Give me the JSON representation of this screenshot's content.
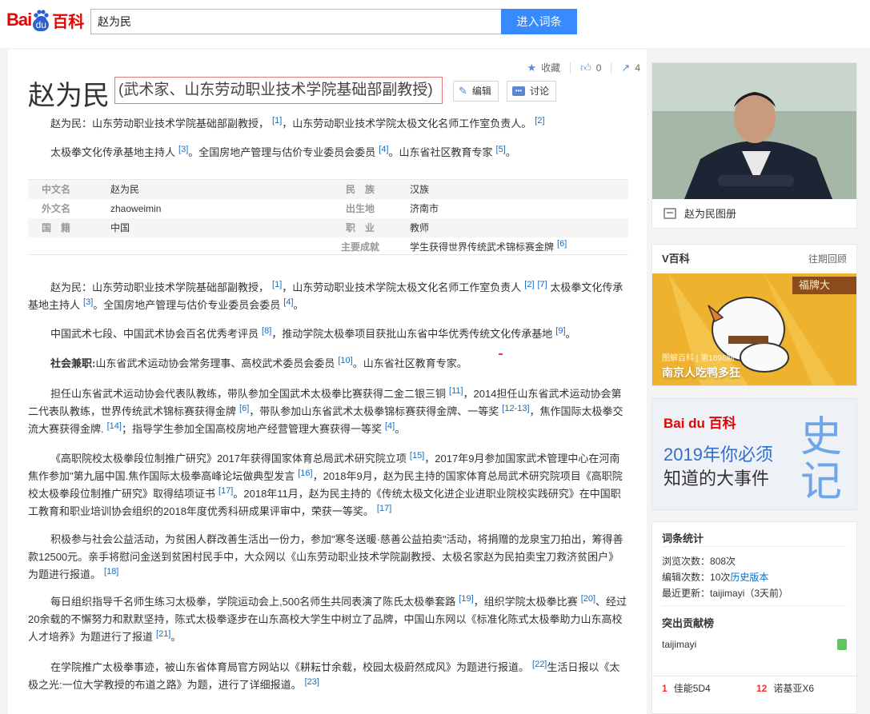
{
  "header": {
    "logo_bai": "Bai",
    "logo_du": "du",
    "logo_baike": "百科",
    "search_value": "赵为民",
    "search_button": "进入词条"
  },
  "toolbar": {
    "favorite_label": "收藏",
    "like_count": "0",
    "share_count": "4"
  },
  "lemma": {
    "title": "赵为民",
    "subtitle": "(武术家、山东劳动职业技术学院基础部副教授)",
    "edit_label": "编辑",
    "discuss_label": "讨论"
  },
  "summary": {
    "p1_text": "赵为民：山东劳动职业技术学院基础部副教授，",
    "p1_ref1": "[1]",
    "p1_text2": "，山东劳动职业技术学院太极文化名师工作室负责人。",
    "p1_ref2": "[2]",
    "p2_text": "太极拳文化传承基地主持人",
    "p2_ref1": "[3]",
    "p2_text2": "。全国房地产管理与估价专业委员会委员",
    "p2_ref2": "[4]",
    "p2_text3": "。山东省社区教育专家",
    "p2_ref3": "[5]",
    "p2_text4": "。"
  },
  "basic_info": {
    "left": [
      {
        "key": "中文名",
        "value": "赵为民"
      },
      {
        "key": "外文名",
        "value": "zhaoweimin"
      },
      {
        "key": "国　籍",
        "value": "中国"
      }
    ],
    "right": [
      {
        "key": "民　族",
        "value": "汉族"
      },
      {
        "key": "出生地",
        "value": "济南市"
      },
      {
        "key": "职　业",
        "value": "教师"
      },
      {
        "key": "主要成就",
        "value": "学生获得世界传统武术锦标赛金牌",
        "ref": "[6]"
      }
    ]
  },
  "body": {
    "b1": {
      "t1": "赵为民：山东劳动职业技术学院基础部副教授，",
      "r1": "[1]",
      "t2": "，山东劳动职业技术学院太极文化名师工作室负责人",
      "r2": "[2]",
      "r3": "[7]",
      "t3": "太极拳文化传承基地主持人",
      "r4": "[3]",
      "t4": "。全国房地产管理与估价专业委员会委员",
      "r5": "[4]",
      "t5": "。"
    },
    "b2": {
      "t1": "中国武术七段、中国武术协会百名优秀考评员",
      "r1": "[8]",
      "t2": "，推动学院太极拳项目获批山东省中华优秀传统文化传承基地",
      "r2": "[9]",
      "t3": "。"
    },
    "b3": {
      "label": "社会兼职:",
      "t1": "山东省武术运动协会常务理事、高校武术委员会委员",
      "r1": "[10]",
      "t2": "。山东省社区教育专家。"
    },
    "b4": {
      "t1": "担任山东省武术运动协会代表队教练，带队参加全国武术太极拳比赛获得二金二银三铜",
      "r1": "[11]",
      "t2": "，2014担任山东省武术运动协会第二代表队教练，世界传统武术锦标赛获得金牌",
      "r2": "[6]",
      "t3": "，带队参加山东省武术太极拳锦标赛获得金牌、一等奖",
      "r3": "[12-13]",
      "t4": "，焦作国际太极拳交流大赛获得金牌.",
      "r4": "[14]",
      "t5": "；指导学生参加全国高校房地产经营管理大赛获得一等奖",
      "r5": "[4]",
      "t6": "。"
    },
    "b5": {
      "t1": "《高职院校太极拳段位制推广研究》2017年获得国家体育总局武术研究院立项",
      "r1": "[15]",
      "t2": "，2017年9月参加国家武术管理中心在河南焦作参加\"第九届中国.焦作国际太极拳高峰论坛做典型发言",
      "r2": "[16]",
      "t3": "，2018年9月，赵为民主持的国家体育总局武术研究院项目《高职院校太极拳段位制推广研究》取得结项证书",
      "r3": "[17]",
      "t4": "。2018年11月，赵为民主持的《传统太极文化进企业进职业院校实践研究》在中国职工教育和职业培训协会组织的2018年度优秀科研成果评审中，荣获一等奖。",
      "r4": "[17]"
    },
    "b6": {
      "t1": "积极参与社会公益活动，为贫困人群改善生活出一份力，参加\"寒冬送暖·慈善公益拍卖\"活动，将捐赠的龙泉宝刀拍出，筹得善款12500元。亲手将慰问金送到贫困村民手中，大众网以《山东劳动职业技术学院副教授、太极名家赵为民拍卖宝刀救济贫困户》为题进行报道。",
      "r1": "[18]"
    },
    "b7": {
      "t1": "每日组织指导千名师生练习太极拳，学院运动会上,500名师生共同表演了陈氏太极拳套路",
      "r1": "[19]",
      "t2": "，组织学院太极拳比赛",
      "r2": "[20]",
      "t3": "、经过20余载的不懈努力和默默坚持，陈式太极拳逐步在山东高校大学生中树立了品牌，中国山东网以《标准化陈式太极拳助力山东高校人才培养》为题进行了报道",
      "r3": "[21]",
      "t4": "。"
    },
    "b8": {
      "t1": "在学院推广太极拳事迹，被山东省体育局官方网站以《耕耘廿余载，校园太极蔚然成风》为题进行报道。",
      "r1": "[22]",
      "t2": "生活日报以《太极之光:一位大学教授的布道之路》为题，进行了详细报道。",
      "r2": "[23]"
    }
  },
  "sidebar": {
    "album_label": "赵为民图册",
    "vbaike_title": "V百科",
    "vbaike_more": "往期回顾",
    "vbaike_meta": "图解百科 | 第1896期",
    "vbaike_caption": "南京人吃鸭多狂",
    "vbaike_sign": "福牌大",
    "ad_logo": "Bai du 百科",
    "ad_line1": "2019年你必须",
    "ad_line2": "知道的大事件",
    "ad_big": "史记",
    "stats_title": "词条统计",
    "views_label": "浏览次数：",
    "views_value": "808次",
    "edits_label": "编辑次数：",
    "edits_value": "10次",
    "history_link": "历史版本",
    "updated_label": "最近更新：",
    "updated_value": "taijimayi（3天前）",
    "contrib_title": "突出贡献榜",
    "contrib_user": "taijimayi",
    "hot": [
      {
        "n": "1",
        "t": "佳能5D4"
      },
      {
        "n": "12",
        "t": "诺基亚X6"
      }
    ]
  }
}
